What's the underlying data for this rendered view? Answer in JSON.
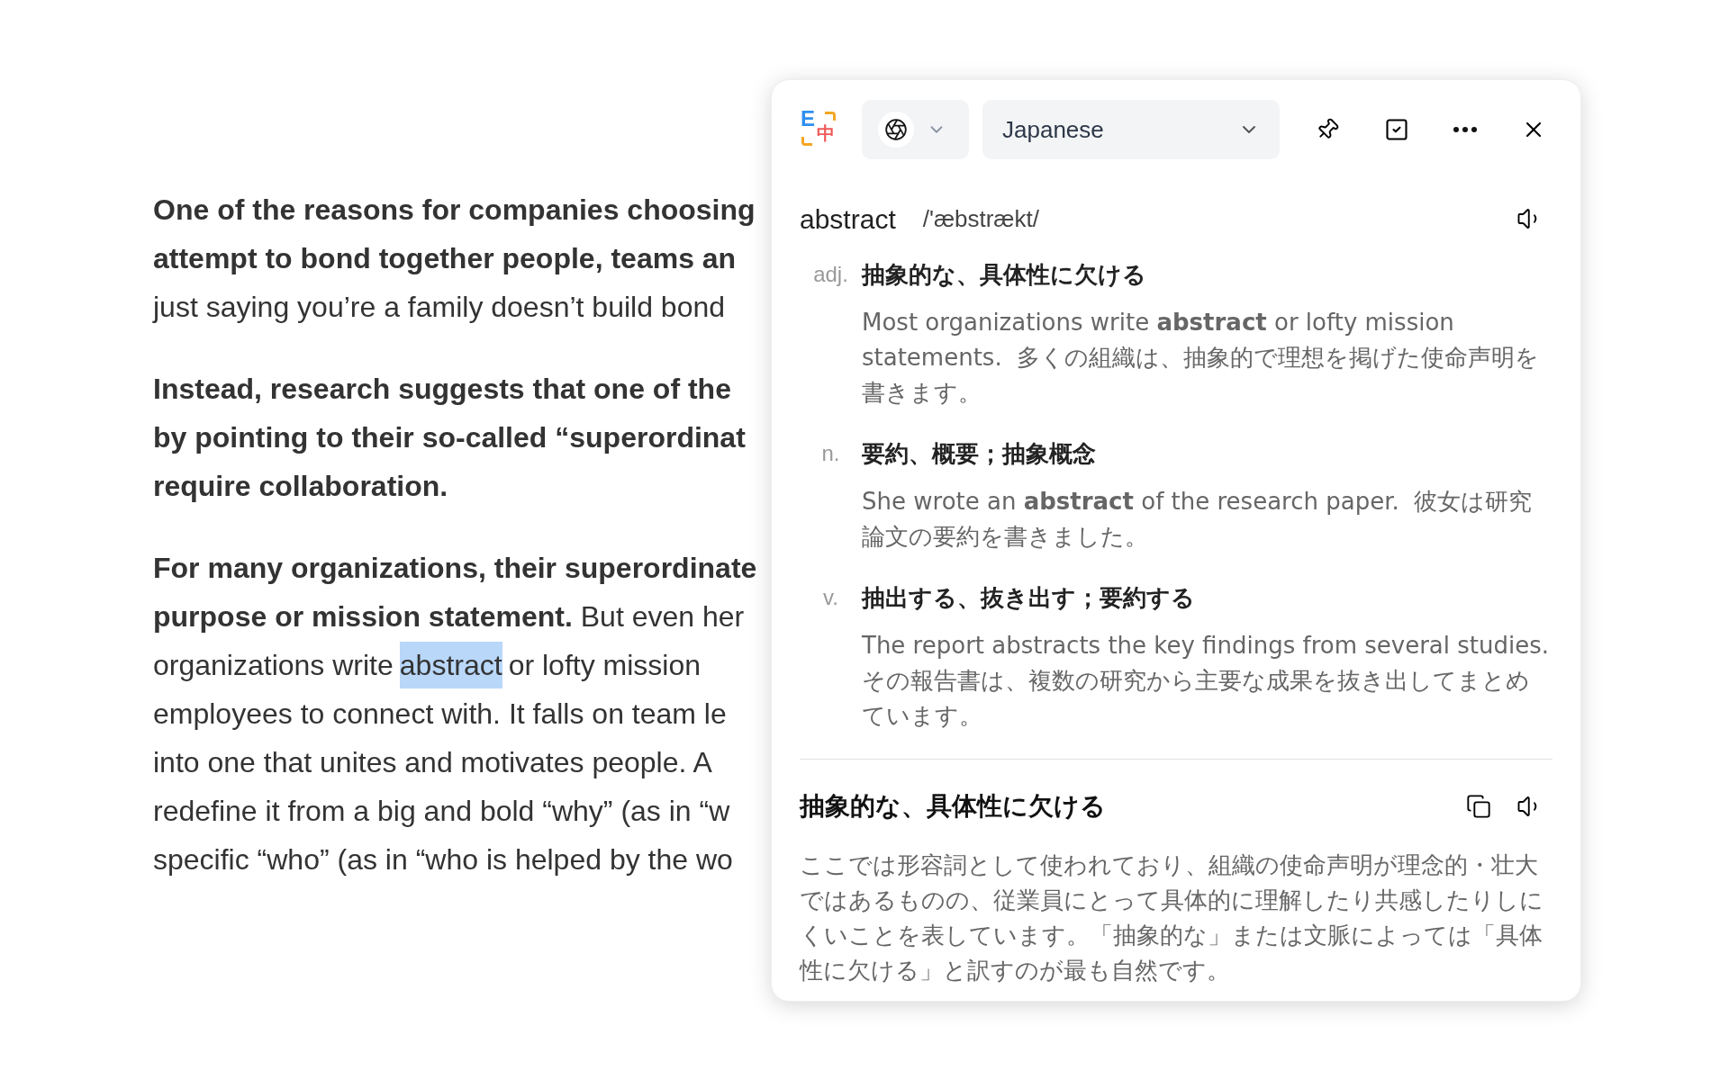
{
  "article": {
    "paragraphs": [
      {
        "lines": [
          {
            "kind": "plain",
            "text": "**One of the reasons for companies choosing**"
          },
          {
            "kind": "plain",
            "text": "**attempt to bond together people, teams an**"
          },
          {
            "kind": "plain",
            "text": "just saying you’re a family doesn’t build bond"
          }
        ]
      },
      {
        "lines": [
          {
            "kind": "plain",
            "text": "**Instead, research suggests that one of the**"
          },
          {
            "kind": "plain",
            "text": "**by pointing to their so-called “superordinat**"
          },
          {
            "kind": "plain",
            "text": "**require collaboration.**"
          }
        ]
      },
      {
        "lines": [
          {
            "kind": "plain",
            "text": "**For many organizations, their superordinate**"
          },
          {
            "kind": "plain",
            "text": "**purpose or mission statement.** But even her"
          },
          {
            "kind": "selection",
            "before": "organizations write",
            "selected": "abstract",
            "after": "or lofty mission"
          },
          {
            "kind": "plain",
            "text": "employees to connect with. It falls on team le"
          },
          {
            "kind": "plain",
            "text": "into one that unites and motivates people. A"
          },
          {
            "kind": "plain",
            "text": "redefine it from a big and bold “why” (as in “w"
          },
          {
            "kind": "plain",
            "text": "specific “who” (as in “who is helped by the wo"
          }
        ]
      }
    ]
  },
  "popup": {
    "logo": {
      "letter_1": "E",
      "letter_2": "中"
    },
    "language": "Japanese",
    "headword": "abstract",
    "phonetic": "/'æbstrækt/",
    "senses": [
      {
        "pos": "adj.",
        "meaning": "抽象的な、具体性に欠ける",
        "example": "Most organizations write **abstract** or lofty mission statements.  多くの組織は、抽象的で理想を掲げた使命声明を書きます。"
      },
      {
        "pos": "n.",
        "meaning": "要約、概要；抽象概念",
        "example": "She wrote an **abstract** of the research paper.  彼女は研究論文の要約を書きました。"
      },
      {
        "pos": "v.",
        "meaning": "抽出する、抜き出す；要約する",
        "example": "The report abstracts the key findings from several studies. その報告書は、複数の研究から主要な成果を抜き出してまとめています。"
      }
    ],
    "translation": {
      "title": "抽象的な、具体性に欠ける",
      "explanation": "ここでは形容詞として使われており、組織の使命声明が理念的・壮大ではあるものの、従業員にとって具体的に理解したり共感したりしにくいことを表しています。「抽象的な」または文脈によっては「具体性に欠ける」と訳すのが最も自然です。"
    }
  }
}
